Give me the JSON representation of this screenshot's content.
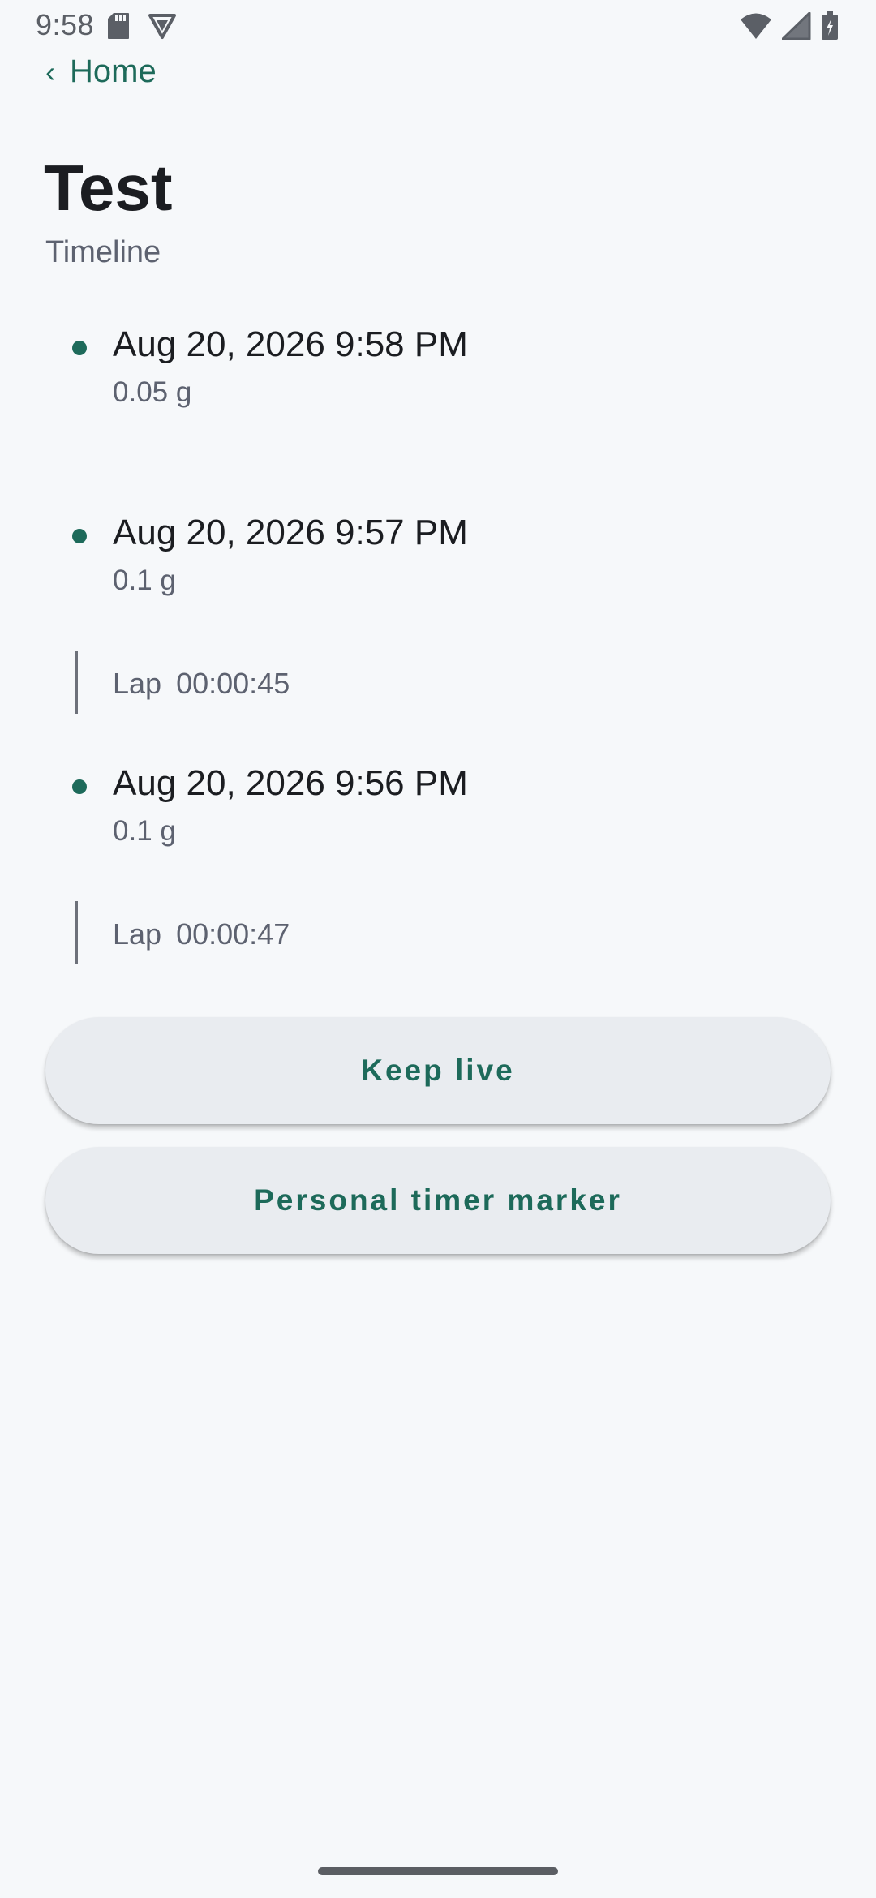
{
  "status_bar": {
    "time": "9:58",
    "icons_left": [
      "sd-card-icon",
      "vpn-shield-icon"
    ],
    "icons_right": [
      "wifi-icon",
      "cellular-signal-icon",
      "battery-charging-icon"
    ]
  },
  "nav": {
    "back_chevron": "‹",
    "back_label": "Home"
  },
  "header": {
    "title": "Test",
    "subtitle": "Timeline"
  },
  "timeline": {
    "entries": [
      {
        "time": "Aug 20, 2026 9:58 PM",
        "amount": "0.05 g"
      },
      {
        "time": "Aug 20, 2026 9:57 PM",
        "amount": "0.1 g"
      },
      {
        "time": "Aug 20, 2026 9:56 PM",
        "amount": "0.1 g"
      }
    ],
    "laps": [
      {
        "label": "Lap",
        "duration": "00:00:45"
      },
      {
        "label": "Lap",
        "duration": "00:00:47"
      }
    ]
  },
  "actions": {
    "keep_live_label": "Keep live",
    "timer_marker_label": "Personal timer marker"
  },
  "colors": {
    "accent": "#1d6a5a",
    "background": "#f6f8fa",
    "button_bg": "#e9ecf0",
    "muted_text": "#5d6270"
  }
}
